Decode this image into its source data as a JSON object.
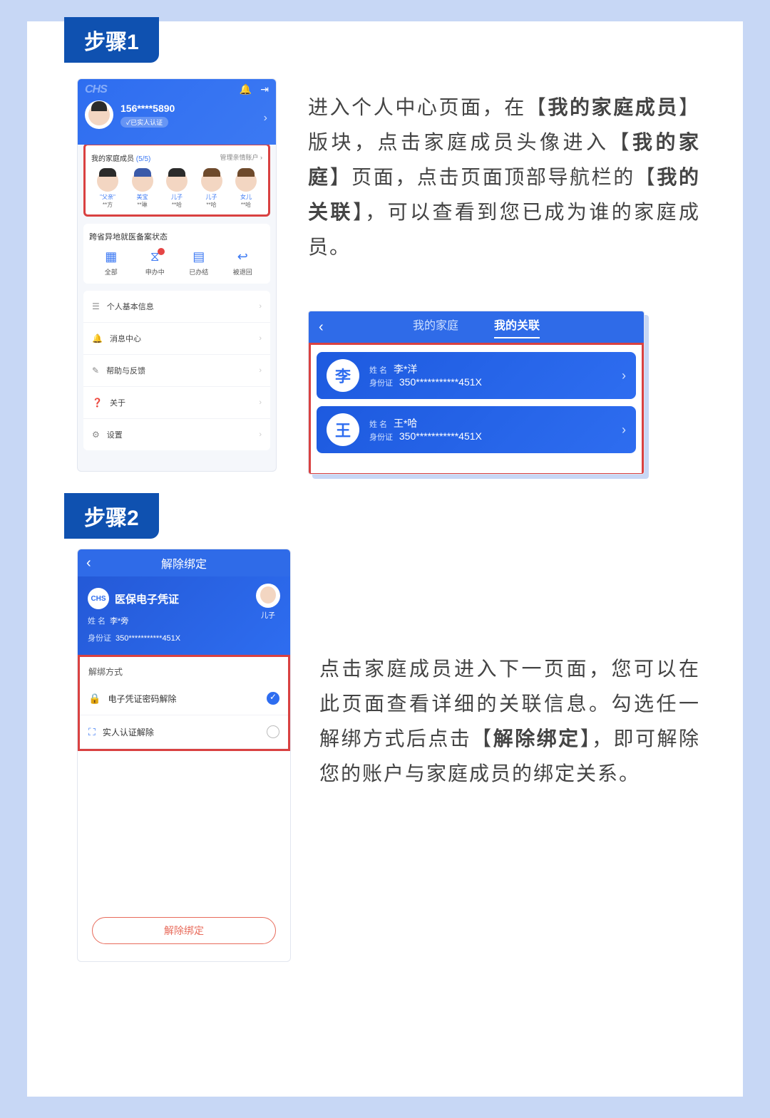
{
  "steps": {
    "step1_label": "步骤1",
    "step2_label": "步骤2"
  },
  "instruction1": {
    "t1": "进入个人中心页面，在【",
    "b1": "我的家庭成员",
    "t2": "】版块，点击家庭成员头像进入【",
    "b2": "我的家庭",
    "t3": "】页面，点击页面顶部导航栏的【",
    "b3": "我的关联",
    "t4": "】，可以查看到您已成为谁的家庭成员。"
  },
  "instruction2": {
    "t1": "点击家庭成员进入下一页面，您可以在此页面查看详细的关联信息。勾选任一解绑方式后点击【",
    "b1": "解除绑定",
    "t2": "】，即可解除您的账户与家庭成员的绑定关系。"
  },
  "phone1": {
    "logo": "CHS",
    "phone": "156****5890",
    "verified": "✓已实人认证",
    "family_title": "我的家庭成员",
    "family_count": "(5/5)",
    "family_manage": "管理亲情账户 ›",
    "members": [
      {
        "role": "\"父亲\"",
        "name": "**方"
      },
      {
        "role": "美宝",
        "name": "**琳"
      },
      {
        "role": "儿子",
        "name": "**哈"
      },
      {
        "role": "儿子",
        "name": "**哈"
      },
      {
        "role": "女儿",
        "name": "**哈"
      }
    ],
    "status_title": "跨省异地就医备案状态",
    "status_items": [
      "全部",
      "申办中",
      "已办结",
      "被退回"
    ],
    "menu": [
      "个人基本信息",
      "消息中心",
      "帮助与反馈",
      "关于",
      "设置"
    ],
    "menu_icons": [
      "☰",
      "🔔",
      "✎",
      "❓",
      "⚙"
    ]
  },
  "mini": {
    "tab1": "我的家庭",
    "tab2": "我的关联",
    "cards": [
      {
        "glyph": "李",
        "name_label": "姓 名",
        "name": "李*洋",
        "id_label": "身份证",
        "id": "350***********451X"
      },
      {
        "glyph": "王",
        "name_label": "姓 名",
        "name": "王*哈",
        "id_label": "身份证",
        "id": "350***********451X"
      }
    ]
  },
  "phone2": {
    "title": "解除绑定",
    "card_title": "医保电子凭证",
    "name_label": "姓 名",
    "name": "李*旁",
    "id_label": "身份证",
    "id": "350***********451X",
    "avatar_role": "儿子",
    "section_title": "解绑方式",
    "opt1": "电子凭证密码解除",
    "opt2": "实人认证解除",
    "btn": "解除绑定",
    "chs": "CHS"
  }
}
